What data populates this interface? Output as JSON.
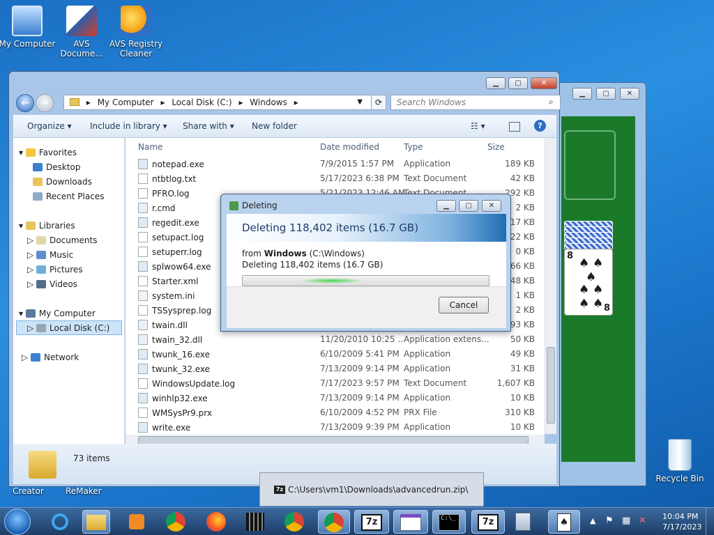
{
  "desktop": {
    "icons": [
      {
        "label": "My Computer"
      },
      {
        "label": "AVS Docume..."
      },
      {
        "label": "AVS Registry Cleaner"
      }
    ],
    "partial_labels": [
      "Creator",
      "ReMaker"
    ],
    "recycle_bin": "Recycle Bin"
  },
  "explorer": {
    "address": [
      "My Computer",
      "Local Disk (C:)",
      "Windows"
    ],
    "search_placeholder": "Search Windows",
    "toolbar": {
      "organize": "Organize",
      "include": "Include in library",
      "share": "Share with",
      "new_folder": "New folder"
    },
    "nav": {
      "favorites": "Favorites",
      "desktop": "Desktop",
      "downloads": "Downloads",
      "recent": "Recent Places",
      "libraries": "Libraries",
      "documents": "Documents",
      "music": "Music",
      "pictures": "Pictures",
      "videos": "Videos",
      "my_computer": "My Computer",
      "local_disk": "Local Disk (C:)",
      "network": "Network"
    },
    "columns": {
      "name": "Name",
      "date": "Date modified",
      "type": "Type",
      "size": "Size"
    },
    "files": [
      {
        "name": "notepad.exe",
        "date": "7/9/2015 1:57 PM",
        "type": "Application",
        "size": "189 KB"
      },
      {
        "name": "ntbtlog.txt",
        "date": "5/17/2023 6:38 PM",
        "type": "Text Document",
        "size": "42 KB"
      },
      {
        "name": "PFRO.log",
        "date": "5/21/2023 12:46 AM",
        "type": "Text Document",
        "size": "292 KB"
      },
      {
        "name": "r.cmd",
        "date": "",
        "type": "",
        "size": "2 KB"
      },
      {
        "name": "regedit.exe",
        "date": "",
        "type": "",
        "size": "417 KB"
      },
      {
        "name": "setupact.log",
        "date": "",
        "type": "",
        "size": "22 KB"
      },
      {
        "name": "setuperr.log",
        "date": "",
        "type": "",
        "size": "0 KB"
      },
      {
        "name": "splwow64.exe",
        "date": "",
        "type": "",
        "size": "66 KB"
      },
      {
        "name": "Starter.xml",
        "date": "",
        "type": "",
        "size": "48 KB"
      },
      {
        "name": "system.ini",
        "date": "",
        "type": "",
        "size": "1 KB"
      },
      {
        "name": "TSSysprep.log",
        "date": "",
        "type": "",
        "size": "2 KB"
      },
      {
        "name": "twain.dll",
        "date": "",
        "type": "",
        "size": "93 KB"
      },
      {
        "name": "twain_32.dll",
        "date": "11/20/2010 10:25 ...",
        "type": "Application extens...",
        "size": "50 KB"
      },
      {
        "name": "twunk_16.exe",
        "date": "6/10/2009 5:41 PM",
        "type": "Application",
        "size": "49 KB"
      },
      {
        "name": "twunk_32.exe",
        "date": "7/13/2009 9:14 PM",
        "type": "Application",
        "size": "31 KB"
      },
      {
        "name": "WindowsUpdate.log",
        "date": "7/17/2023 9:57 PM",
        "type": "Text Document",
        "size": "1,607 KB"
      },
      {
        "name": "winhlp32.exe",
        "date": "7/13/2009 9:14 PM",
        "type": "Application",
        "size": "10 KB"
      },
      {
        "name": "WMSysPr9.prx",
        "date": "6/10/2009 4:52 PM",
        "type": "PRX File",
        "size": "310 KB"
      },
      {
        "name": "write.exe",
        "date": "7/13/2009 9:39 PM",
        "type": "Application",
        "size": "10 KB"
      }
    ],
    "status_count": "73 items"
  },
  "dialog": {
    "title": "Deleting",
    "heading": "Deleting 118,402 items (16.7 GB)",
    "from_prefix": "from",
    "from_bold": "Windows",
    "from_path": "(C:\\Windows)",
    "detail": "Deleting 118,402 items (16.7 GB)",
    "cancel": "Cancel"
  },
  "tooltip": {
    "text": "C:\\Users\\vm1\\Downloads\\advancedrun.zip\\"
  },
  "taskbar": {
    "time": "10:04 PM",
    "date": "7/17/2023",
    "apps": [
      "start",
      "ie",
      "explorer",
      "media-player",
      "chrome",
      "firefox",
      "video",
      "chrome",
      "chrome",
      "7zip",
      "dialog",
      "cmd",
      "7zip",
      "calculator",
      "solitaire"
    ]
  },
  "solitaire": {
    "card_rank": "8",
    "card_suit": "♠"
  }
}
